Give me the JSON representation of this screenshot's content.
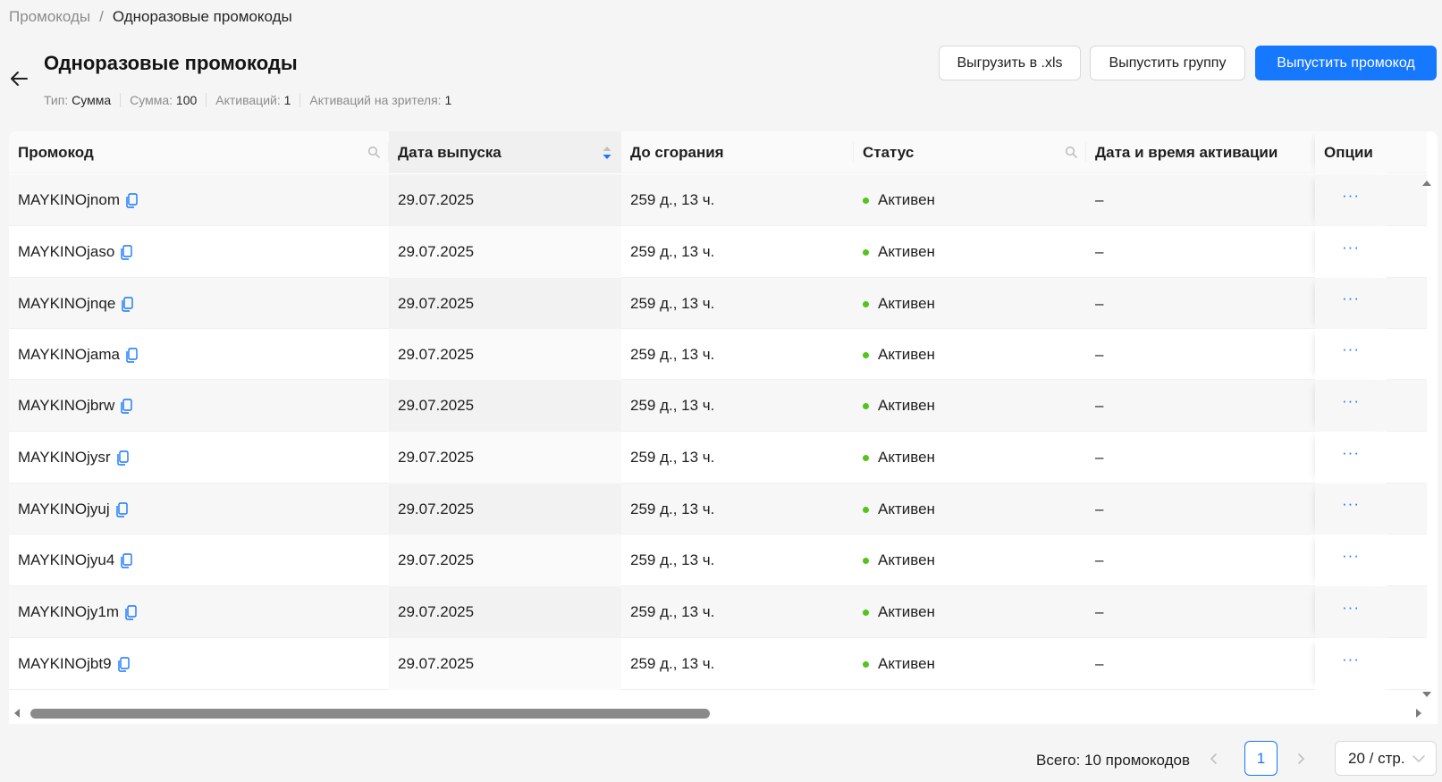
{
  "breadcrumb": {
    "root": "Промокоды",
    "separator": "/",
    "current": "Одноразовые промокоды"
  },
  "header": {
    "title": "Одноразовые промокоды",
    "meta": [
      {
        "label": "Тип:",
        "value": "Сумма"
      },
      {
        "label": "Сумма:",
        "value": "100"
      },
      {
        "label": "Активаций:",
        "value": "1"
      },
      {
        "label": "Активаций на зрителя:",
        "value": "1"
      }
    ]
  },
  "actions": {
    "export_label": "Выгрузить в .xls",
    "issue_group_label": "Выпустить группу",
    "issue_promo_label": "Выпустить промокод"
  },
  "colors": {
    "primary": "#1677ff",
    "active_status": "#52c41a"
  },
  "table": {
    "columns": {
      "code": "Промокод",
      "issue_date": "Дата выпуска",
      "until_expire": "До сгорания",
      "status": "Статус",
      "activation_datetime": "Дата и время активации",
      "options": "Опции"
    },
    "options_glyph": "···",
    "rows": [
      {
        "code": "MAYKINOjnom",
        "issue_date": "29.07.2025",
        "until_expire": "259 д., 13 ч.",
        "status": "Активен",
        "activation": "–"
      },
      {
        "code": "MAYKINOjaso",
        "issue_date": "29.07.2025",
        "until_expire": "259 д., 13 ч.",
        "status": "Активен",
        "activation": "–"
      },
      {
        "code": "MAYKINOjnqe",
        "issue_date": "29.07.2025",
        "until_expire": "259 д., 13 ч.",
        "status": "Активен",
        "activation": "–"
      },
      {
        "code": "MAYKINOjama",
        "issue_date": "29.07.2025",
        "until_expire": "259 д., 13 ч.",
        "status": "Активен",
        "activation": "–"
      },
      {
        "code": "MAYKINOjbrw",
        "issue_date": "29.07.2025",
        "until_expire": "259 д., 13 ч.",
        "status": "Активен",
        "activation": "–"
      },
      {
        "code": "MAYKINOjysr",
        "issue_date": "29.07.2025",
        "until_expire": "259 д., 13 ч.",
        "status": "Активен",
        "activation": "–"
      },
      {
        "code": "MAYKINOjyuj",
        "issue_date": "29.07.2025",
        "until_expire": "259 д., 13 ч.",
        "status": "Активен",
        "activation": "–"
      },
      {
        "code": "MAYKINOjyu4",
        "issue_date": "29.07.2025",
        "until_expire": "259 д., 13 ч.",
        "status": "Активен",
        "activation": "–"
      },
      {
        "code": "MAYKINOjy1m",
        "issue_date": "29.07.2025",
        "until_expire": "259 д., 13 ч.",
        "status": "Активен",
        "activation": "–"
      },
      {
        "code": "MAYKINOjbt9",
        "issue_date": "29.07.2025",
        "until_expire": "259 д., 13 ч.",
        "status": "Активен",
        "activation": "–"
      }
    ]
  },
  "pagination": {
    "total_label": "Всего: 10 промокодов",
    "current_page": "1",
    "page_size_label": "20 / стр."
  }
}
